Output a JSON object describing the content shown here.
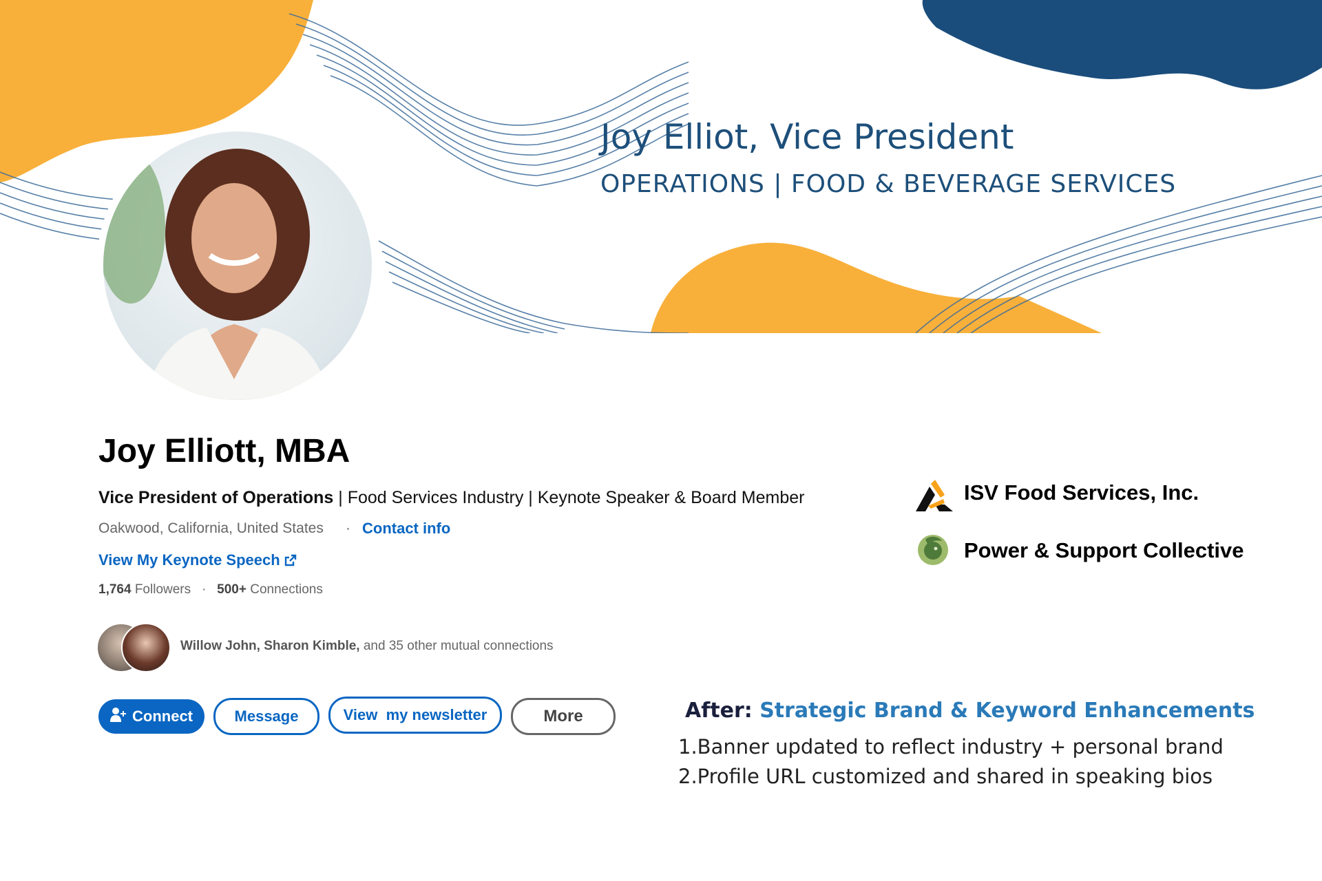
{
  "banner": {
    "title": "Joy Elliot, Vice President",
    "subtitle": "OPERATIONS | FOOD & BEVERAGE SERVICES",
    "colors": {
      "orange": "#f8b03b",
      "navy": "#1a4d7c",
      "lines": "#3a6a9a"
    }
  },
  "profile": {
    "name": "Joy Elliott, MBA",
    "headline_bold": "Vice President of Operations",
    "headline_rest": " | Food Services Industry | Keynote Speaker & Board Member",
    "location": "Oakwood, California, United States",
    "contact_info": "Contact info",
    "keynote_link": "View My Keynote Speech",
    "followers_count": "1,764",
    "followers_label": " Followers",
    "connections_count": "500+",
    "connections_label": " Connections",
    "mutual_names": "Willow John, Sharon Kimble,",
    "mutual_rest": " and 35 other mutual connections"
  },
  "actions": {
    "connect": "Connect",
    "message": "Message",
    "newsletter": "View  my newsletter",
    "more": "More"
  },
  "companies": [
    {
      "name": "ISV Food Services, Inc.",
      "icon": "isv-logo-icon"
    },
    {
      "name": "Power & Support Collective",
      "icon": "lion-logo-icon"
    }
  ],
  "enhancements": {
    "heading_key": "After:",
    "heading_value": " Strategic Brand & Keyword Enhancements",
    "items": [
      "1.Banner updated to reflect industry + personal brand",
      "2.Profile URL customized and shared in speaking bios"
    ]
  },
  "accent_colors": {
    "link": "#0a66c2",
    "after_label": "#1a1f3d",
    "after_value": "#2a7ab8"
  }
}
